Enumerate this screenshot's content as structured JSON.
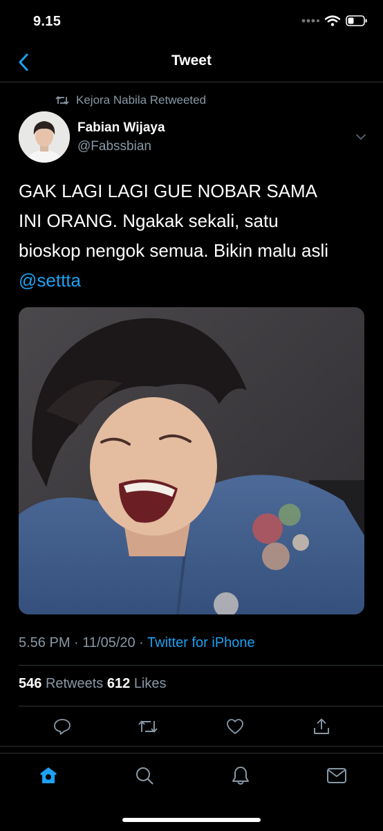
{
  "status_bar": {
    "time": "9.15"
  },
  "nav": {
    "title": "Tweet",
    "back_icon": "chevron-left-icon"
  },
  "tweet": {
    "retweeted_by": "Kejora Nabila Retweeted",
    "author_name": "Fabian Wijaya",
    "author_handle": "@Fabssbian",
    "text": "GAK LAGI LAGI GUE NOBAR SAMA\nINI ORANG. Ngakak sekali, satu\nbioskop nengok semua. Bikin malu asli",
    "mention": "@settta",
    "time": "5.56 PM · 11/05/20 · ",
    "source": "Twitter for iPhone",
    "retweets_count": "546",
    "retweets_label": "Retweets",
    "likes_count": "612",
    "likes_label": "Likes"
  },
  "colors": {
    "accent": "#1da1f2",
    "muted": "#8899a6",
    "background": "#000000",
    "divider": "#2f3336"
  }
}
